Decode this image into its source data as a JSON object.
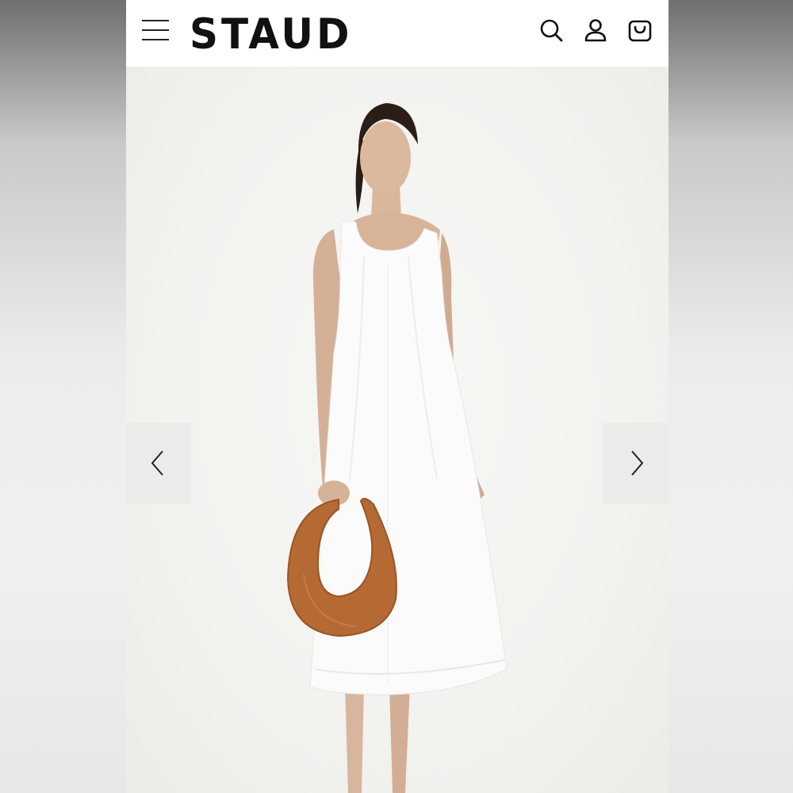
{
  "header": {
    "brand": "STAUD",
    "menu_icon": "hamburger-menu-icon",
    "search_icon": "search-icon",
    "account_icon": "account-icon",
    "bag_icon": "shopping-bag-icon"
  },
  "gallery": {
    "prev_icon": "chevron-left-icon",
    "next_icon": "chevron-right-icon",
    "product_image": "model-in-white-dress-with-tan-moon-bag"
  },
  "colors": {
    "brand_text": "#111111",
    "header_bg": "#ffffff",
    "dress": "#fbfbfb",
    "bag": "#b56a34",
    "page_bg": "#f3f3f1"
  }
}
